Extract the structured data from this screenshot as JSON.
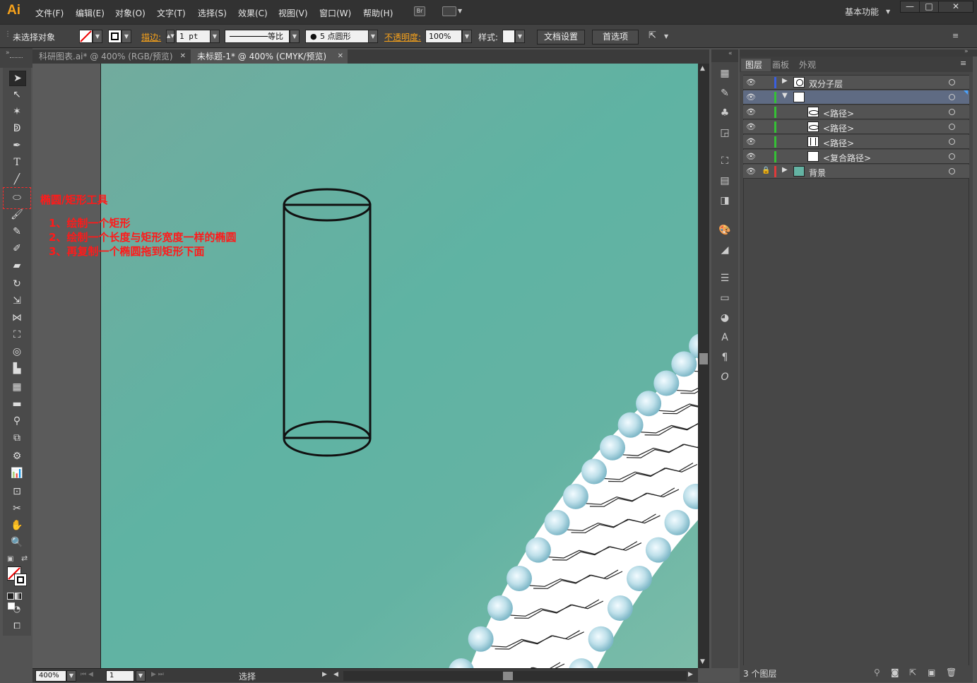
{
  "app": {
    "logo": "Ai"
  },
  "menu": [
    "文件(F)",
    "编辑(E)",
    "对象(O)",
    "文字(T)",
    "选择(S)",
    "效果(C)",
    "视图(V)",
    "窗口(W)",
    "帮助(H)"
  ],
  "menu_icons": {
    "bridge": "Br"
  },
  "workspace": "基本功能",
  "window_buttons": {
    "minimize": "—",
    "maximize": "□",
    "close": "✕"
  },
  "control": {
    "selection": "未选择对象",
    "stroke_label": "描边:",
    "stroke_weight": "1 pt",
    "stroke_profile": "等比",
    "brush": "5 点圆形",
    "opacity_label": "不透明度:",
    "opacity": "100%",
    "style_label": "样式:",
    "doc_setup": "文档设置",
    "preferences": "首选项"
  },
  "tabs": [
    {
      "label": "科研图表.ai* @ 400% (RGB/预览)",
      "active": false
    },
    {
      "label": "未标题-1* @ 400% (CMYK/预览)",
      "active": true
    }
  ],
  "annotation": {
    "title": "椭圆/矩形工具",
    "steps": [
      "1、绘制一个矩形",
      "2、绘制一个长度与矩形宽度一样的椭圆",
      "3、再复制一个椭圆拖到矩形下面"
    ]
  },
  "status": {
    "zoom": "400%",
    "page": "1",
    "mode": "选择"
  },
  "panel": {
    "tabs": [
      "图层",
      "画板",
      "外观"
    ],
    "layers": [
      {
        "name": "双分子层",
        "indent": 0,
        "color": "#3a5fe0",
        "expanded": false,
        "locked": false,
        "selected": false
      },
      {
        "name": "",
        "indent": 0,
        "color": "#35c135",
        "expanded": true,
        "locked": false,
        "selected": true
      },
      {
        "name": "<路径>",
        "indent": 1,
        "color": "#35c135",
        "locked": false,
        "selected": false
      },
      {
        "name": "<路径>",
        "indent": 1,
        "color": "#35c135",
        "locked": false,
        "selected": false
      },
      {
        "name": "<路径>",
        "indent": 1,
        "color": "#35c135",
        "locked": false,
        "selected": false
      },
      {
        "name": "<复合路径>",
        "indent": 1,
        "color": "#35c135",
        "locked": false,
        "selected": false
      },
      {
        "name": "背景",
        "indent": 0,
        "color": "#e03a3a",
        "expanded": false,
        "locked": true,
        "selected": false
      }
    ],
    "footer": "3 个图层"
  },
  "colors": {
    "accent": "#f7a21b",
    "artboard": "#64b3a3",
    "annotation": "#ff1a1a"
  }
}
